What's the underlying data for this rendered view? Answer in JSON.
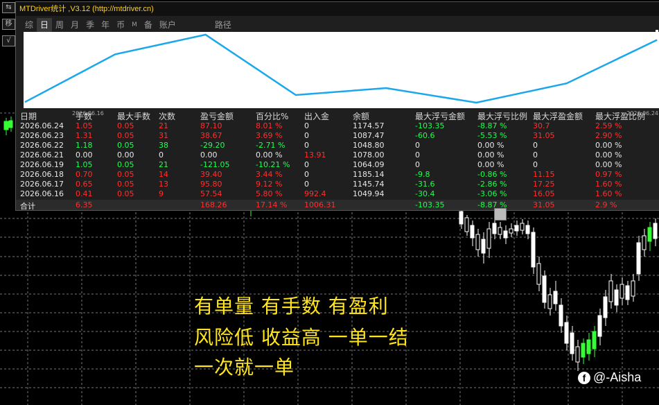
{
  "window": {
    "title": "MTDriver统计 ,V3.12 (http://mtdriver.cn)"
  },
  "tabs": [
    "综",
    "日",
    "周",
    "月",
    "季",
    "年",
    "币",
    "M",
    "备",
    "账户",
    "路径"
  ],
  "active_tab": "日",
  "side_buttons": [
    "⇆",
    "移",
    "√"
  ],
  "chart_data": {
    "type": "line",
    "x": [
      "2026.06.16",
      "2026.06.17",
      "2026.06.18",
      "2026.06.19",
      "2026.06.21",
      "2026.06.22",
      "2026.06.23",
      "2026.06.24"
    ],
    "values": [
      1049.94,
      1145.74,
      1185.14,
      1064.09,
      1078.0,
      1048.8,
      1087.47,
      1174.57
    ],
    "x_start_label": "2026.06.16",
    "x_end_label": "2026.06.24",
    "line_color": "#1aa7ec"
  },
  "table": {
    "headers": [
      "日期",
      "手数",
      "最大手数",
      "次数",
      "盈亏金额",
      "百分比%",
      "出入金",
      "余额",
      "最大浮亏金额",
      "最大浮亏比例",
      "最大浮盈金额",
      "最大浮盈比例"
    ],
    "rows": [
      [
        "2026.06.24",
        "1.05",
        "0.05",
        "21",
        "87.10",
        "8.01 %",
        "0",
        "1174.57",
        "-103.35",
        "-8.87 %",
        "30.7",
        "2.59 %"
      ],
      [
        "2026.06.23",
        "1.31",
        "0.05",
        "31",
        "38.67",
        "3.69 %",
        "0",
        "1087.47",
        "-60.6",
        "-5.53 %",
        "31.05",
        "2.90 %"
      ],
      [
        "2026.06.22",
        "1.18",
        "0.05",
        "38",
        "-29.20",
        "-2.71 %",
        "0",
        "1048.80",
        "0",
        "0.00 %",
        "0",
        "0.00 %"
      ],
      [
        "2026.06.21",
        "0.00",
        "0.00",
        "0",
        "0.00",
        "0.00 %",
        "13.91",
        "1078.00",
        "0",
        "0.00 %",
        "0",
        "0.00 %"
      ],
      [
        "2026.06.19",
        "1.05",
        "0.05",
        "21",
        "-121.05",
        "-10.21 %",
        "0",
        "1064.09",
        "0",
        "0.00 %",
        "0",
        "0.00 %"
      ],
      [
        "2026.06.18",
        "0.70",
        "0.05",
        "14",
        "39.40",
        "3.44 %",
        "0",
        "1185.14",
        "-9.8",
        "-0.86 %",
        "11.15",
        "0.97 %"
      ],
      [
        "2026.06.17",
        "0.65",
        "0.05",
        "13",
        "95.80",
        "9.12 %",
        "0",
        "1145.74",
        "-31.6",
        "-2.86 %",
        "17.25",
        "1.60 %"
      ],
      [
        "2026.06.16",
        "0.41",
        "0.05",
        "9",
        "57.54",
        "5.80 %",
        "992.4",
        "1049.94",
        "-30.4",
        "-3.06 %",
        "16.05",
        "1.60 %"
      ]
    ],
    "row_colors": [
      "red",
      "red",
      "green",
      "white",
      "green",
      "red",
      "red",
      "red"
    ],
    "total": [
      "合计",
      "6.35",
      "",
      "",
      "168.26",
      "17.14 %",
      "1006.31",
      "",
      "-103.35",
      "-8.87 %",
      "31.05",
      "2.9 %"
    ]
  },
  "overlay_text": [
    "有单量 有手数 有盈利",
    "风险低 收益高 一单一结",
    "一次就一单"
  ],
  "watermark": {
    "icon": "facebook-icon",
    "text": "@-Aisha"
  }
}
